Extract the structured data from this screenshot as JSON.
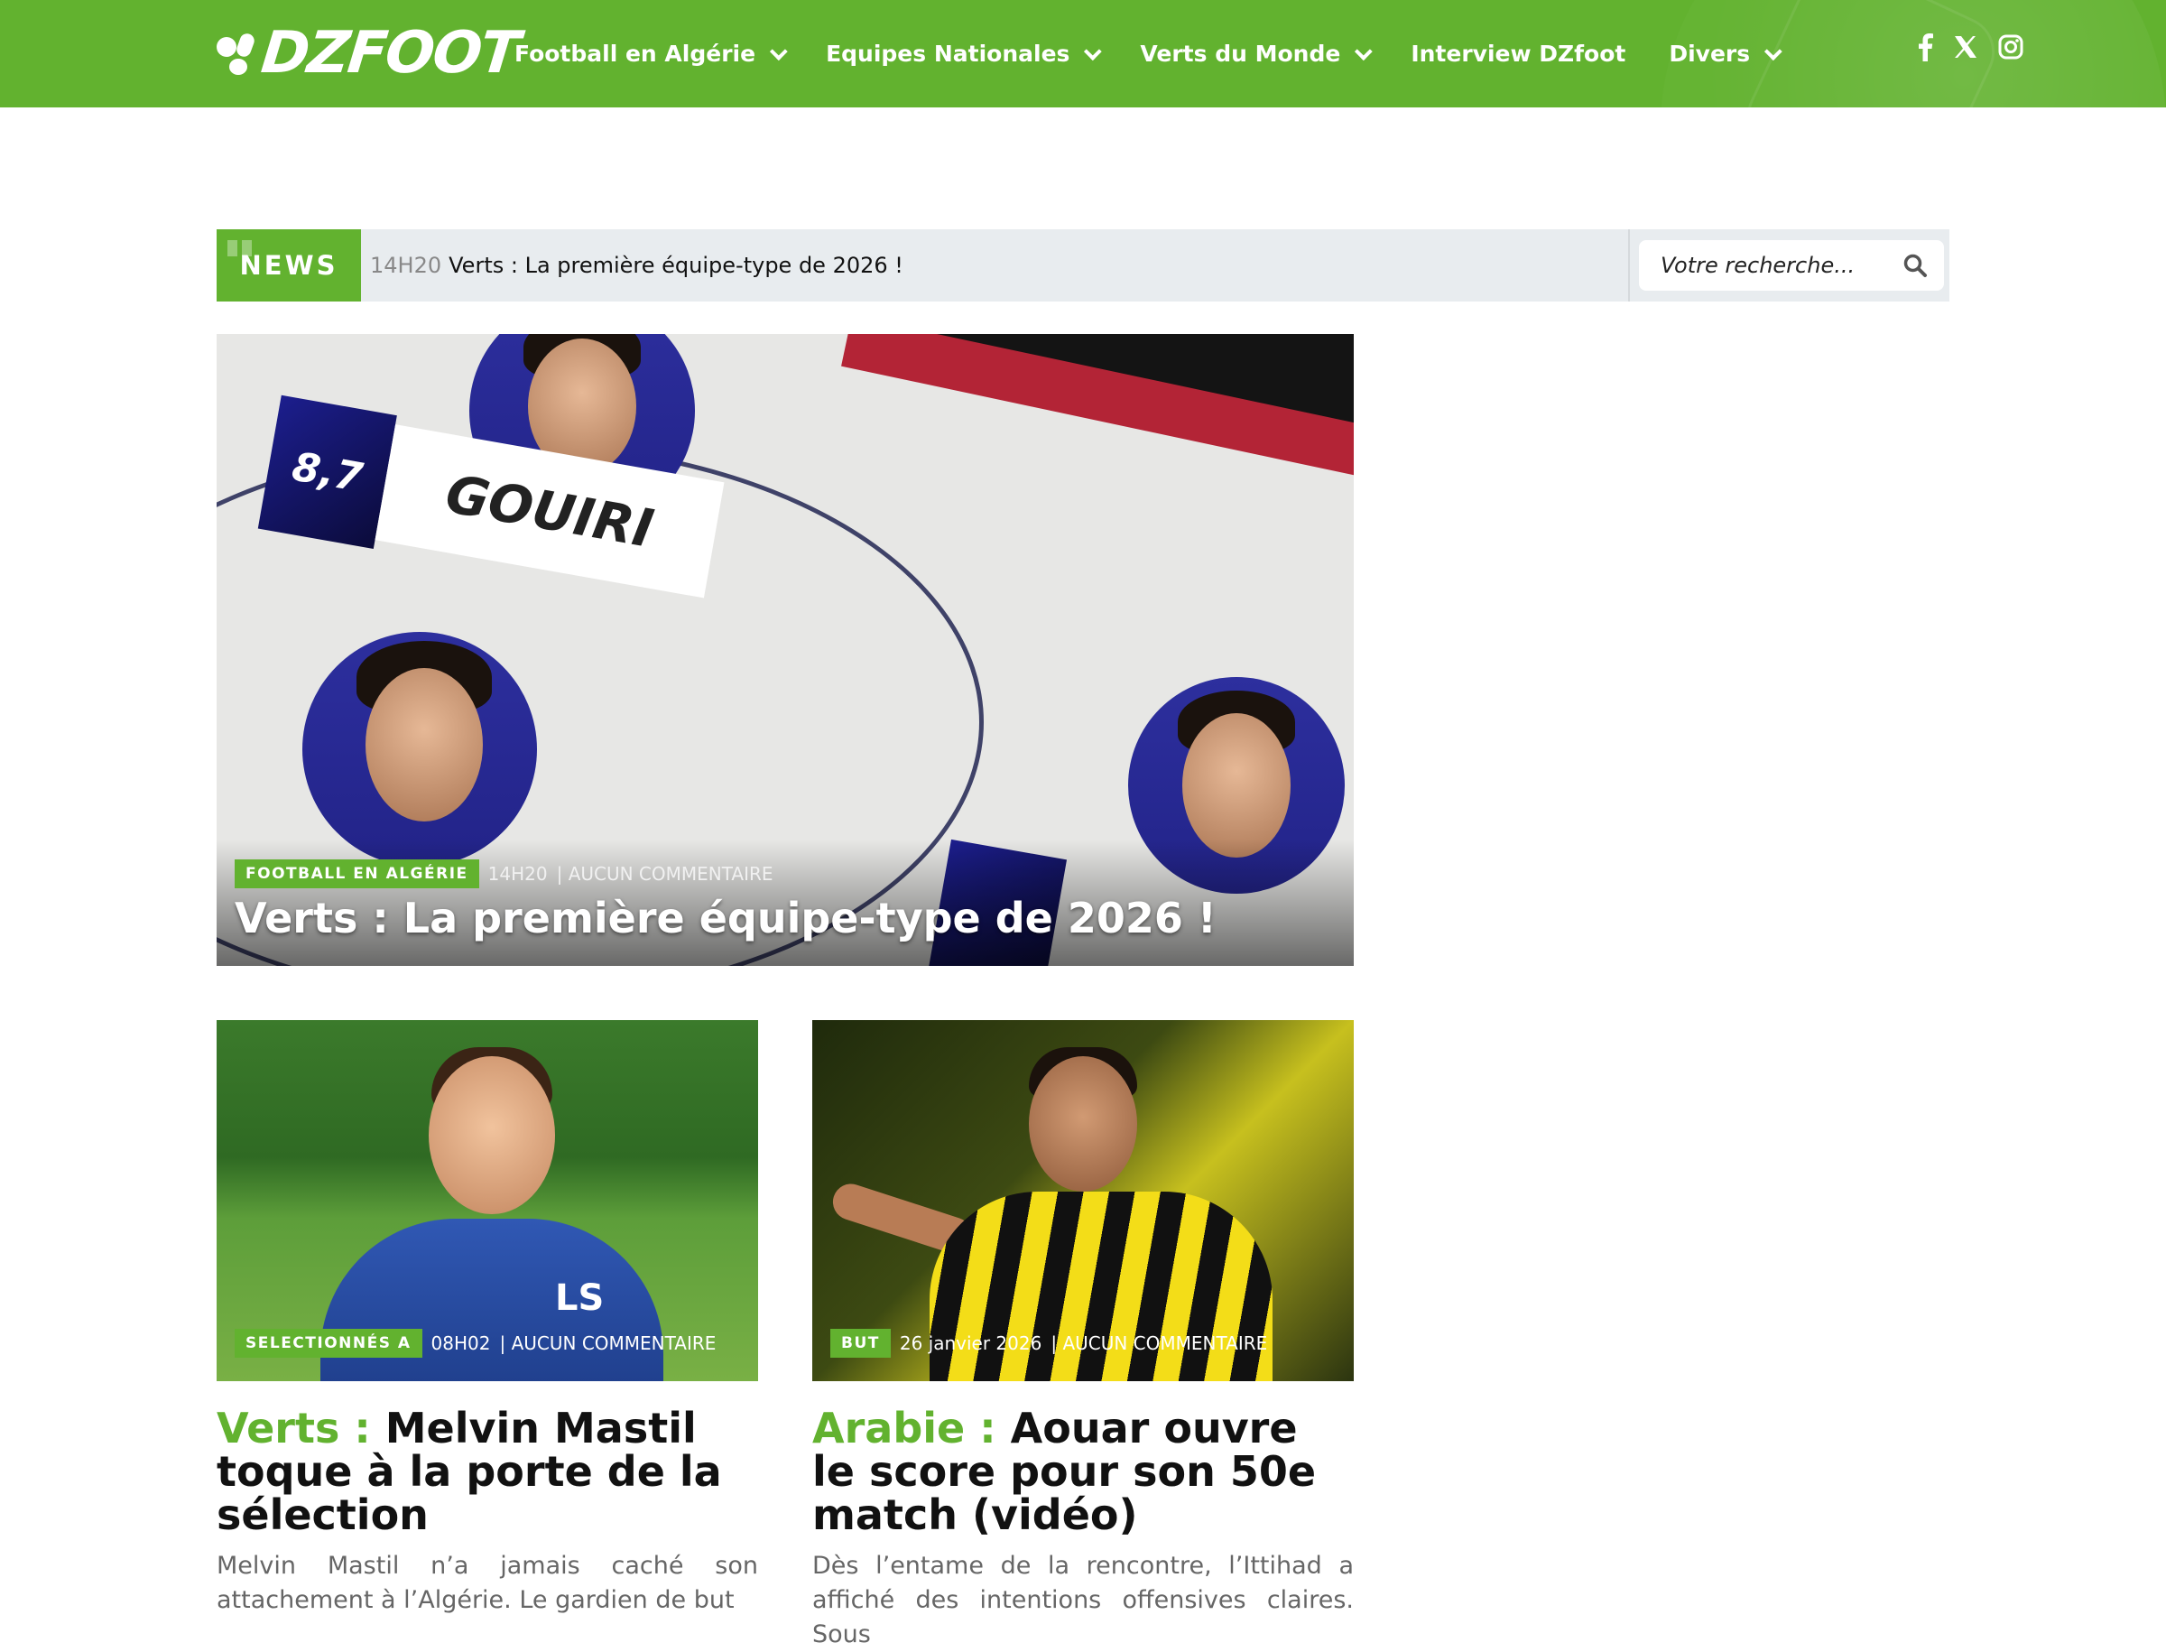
{
  "header": {
    "logo_text": "DZFOOT",
    "nav": [
      {
        "label": "Football en Algérie",
        "dropdown": true
      },
      {
        "label": "Equipes Nationales",
        "dropdown": true
      },
      {
        "label": "Verts du Monde",
        "dropdown": true
      },
      {
        "label": "Interview DZfoot",
        "dropdown": false
      },
      {
        "label": "Divers",
        "dropdown": true
      }
    ],
    "social": [
      "facebook-icon",
      "x-icon",
      "instagram-icon"
    ]
  },
  "news_ticker": {
    "label": "NEWS",
    "time": "14H20",
    "headline": "Verts : La première équipe-type de 2026 !"
  },
  "search": {
    "placeholder": "Votre recherche..."
  },
  "hero": {
    "category": "FOOTBALL EN ALGÉRIE",
    "time": "14H20",
    "comments": "| AUCUN COMMENTAIRE",
    "title": "Verts : La première équipe-type de 2026 !",
    "image_text": {
      "score": "8,7",
      "player": "GOUIRI"
    }
  },
  "cards": [
    {
      "category_badge": "SELECTIONNÉS A",
      "time": "08H02",
      "comments": "| AUCUN COMMENTAIRE",
      "title_prefix": "Verts :",
      "title": " Melvin Mastil toque à la porte de la sélection",
      "excerpt": "Melvin Mastil n’a jamais caché son attachement à l’Algérie. Le gardien de but"
    },
    {
      "category_badge": "BUT",
      "time": "26 janvier 2026",
      "comments": "| AUCUN COMMENTAIRE",
      "title_prefix": "Arabie :",
      "title": " Aouar ouvre le score pour son 50e match (vidéo)",
      "excerpt": "Dès l’entame de la rencontre, l’Ittihad a affiché des intentions offensives claires. Sous"
    }
  ],
  "colors": {
    "brand_green": "#62b22f",
    "ticker_bg": "#e8ecef"
  }
}
